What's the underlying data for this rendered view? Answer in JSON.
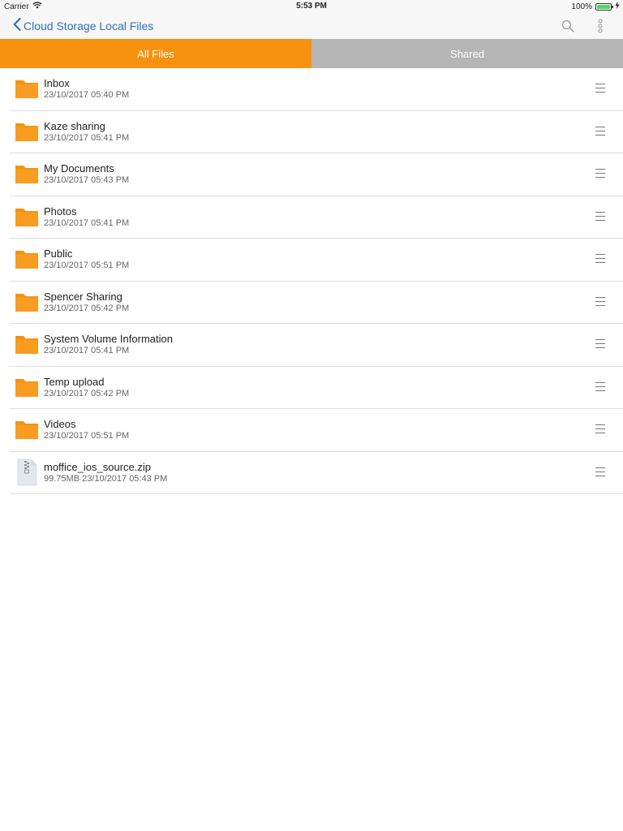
{
  "status_bar": {
    "carrier": "Carrier",
    "time": "5:53 PM",
    "battery_percent": "100%",
    "battery_level": 1.0
  },
  "nav": {
    "back_label": "Cloud Storage Local Files",
    "icons": [
      "search-icon",
      "more-vertical-icon"
    ]
  },
  "tabs": [
    {
      "label": "All Files",
      "active": true
    },
    {
      "label": "Shared",
      "active": false
    }
  ],
  "files": [
    {
      "name": "Inbox",
      "meta": "23/10/2017 05:40 PM",
      "type": "folder"
    },
    {
      "name": "Kaze sharing",
      "meta": "23/10/2017 05:41 PM",
      "type": "folder"
    },
    {
      "name": "My Documents",
      "meta": "23/10/2017 05:43 PM",
      "type": "folder"
    },
    {
      "name": "Photos",
      "meta": "23/10/2017 05:41 PM",
      "type": "folder"
    },
    {
      "name": "Public",
      "meta": "23/10/2017 05:51 PM",
      "type": "folder"
    },
    {
      "name": "Spencer Sharing",
      "meta": "23/10/2017 05:42 PM",
      "type": "folder"
    },
    {
      "name": "System Volume Information",
      "meta": "23/10/2017 05:41 PM",
      "type": "folder"
    },
    {
      "name": "Temp upload",
      "meta": "23/10/2017 05:42 PM",
      "type": "folder"
    },
    {
      "name": "Videos",
      "meta": "23/10/2017 05:51 PM",
      "type": "folder"
    },
    {
      "name": "moffice_ios_source.zip",
      "meta": "99.75MB 23/10/2017 05:43 PM",
      "type": "zip"
    }
  ],
  "colors": {
    "accent": "#f7920f",
    "tab_inactive": "#b5b5b5",
    "link": "#2f6fc0",
    "folder": "#f7920f"
  }
}
